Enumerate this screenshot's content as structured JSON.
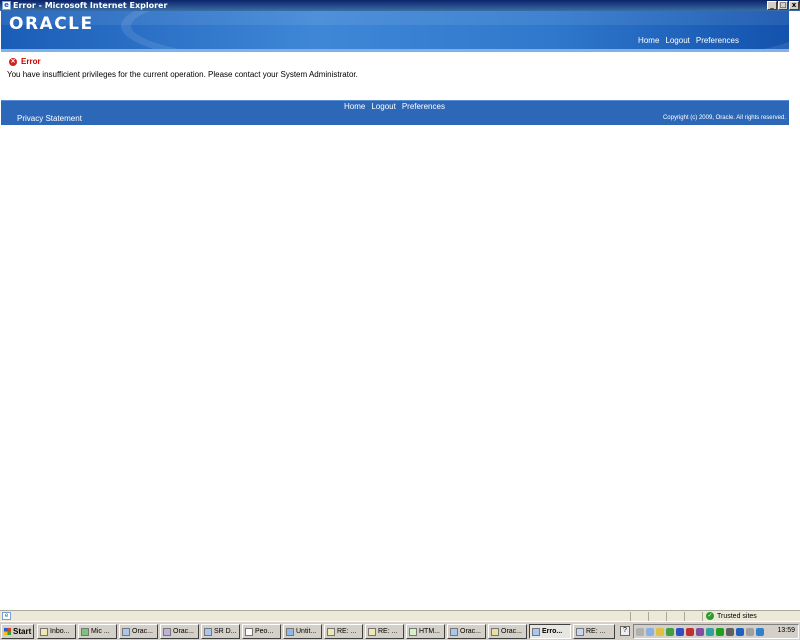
{
  "window": {
    "title": "Error - Microsoft Internet Explorer",
    "minimize": "_",
    "maximize": "□",
    "close": "x"
  },
  "header": {
    "logo": "ORACLE",
    "nav": [
      "Home",
      "Logout",
      "Preferences"
    ]
  },
  "error": {
    "title": "Error",
    "icon": "error-x-icon",
    "message": "You have insufficient privileges for the current operation. Please contact your System Administrator."
  },
  "footer": {
    "nav": [
      "Home",
      "Logout",
      "Preferences"
    ],
    "privacy": "Privacy Statement",
    "copyright": "Copyright (c) 2009, Oracle. All rights reserved."
  },
  "statusbar": {
    "zone": "Trusted sites"
  },
  "taskbar": {
    "start": "Start",
    "tasks": [
      "Inbo...",
      "Mic ...",
      "Orac...",
      "Orac...",
      "SR D...",
      "Peo...",
      "Untit...",
      "RE: ...",
      "RE: ...",
      "HTM...",
      "Orac...",
      "Orac...",
      "Erro...",
      "RE: ..."
    ],
    "active_task": "Erro...",
    "clock": "13:59"
  },
  "colors": {
    "header_blue": "#2f78cc",
    "footer_blue": "#2d68b8",
    "error_red": "#cc0000"
  }
}
